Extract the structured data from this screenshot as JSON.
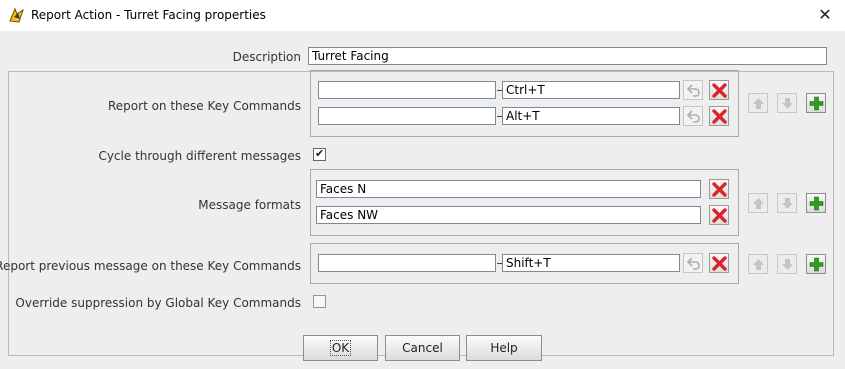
{
  "window": {
    "title": "Report Action - Turret Facing properties",
    "close_glyph": "✕"
  },
  "form": {
    "description": {
      "label": "Description",
      "value": "Turret Facing"
    },
    "report_keys": {
      "label": "Report on these Key Commands",
      "rows": [
        {
          "name": "",
          "keystroke": "Ctrl+T"
        },
        {
          "name": "",
          "keystroke": "Alt+T"
        }
      ]
    },
    "cycle": {
      "label": "Cycle through different messages",
      "checked": true,
      "check_glyph": "✔"
    },
    "message_formats": {
      "label": "Message formats",
      "rows": [
        "Faces N",
        "Faces NW"
      ]
    },
    "previous_keys": {
      "label": "Report previous message on these Key Commands",
      "rows": [
        {
          "name": "",
          "keystroke": "Shift+T"
        }
      ]
    },
    "override": {
      "label": "Override suppression by Global Key Commands",
      "checked": false
    }
  },
  "buttons": {
    "ok": "OK",
    "cancel": "Cancel",
    "help": "Help"
  },
  "colors": {
    "delete_red": "#d8262b",
    "plus_green": "#2f9e1f",
    "disabled_arrow": "#bdbdbd"
  }
}
